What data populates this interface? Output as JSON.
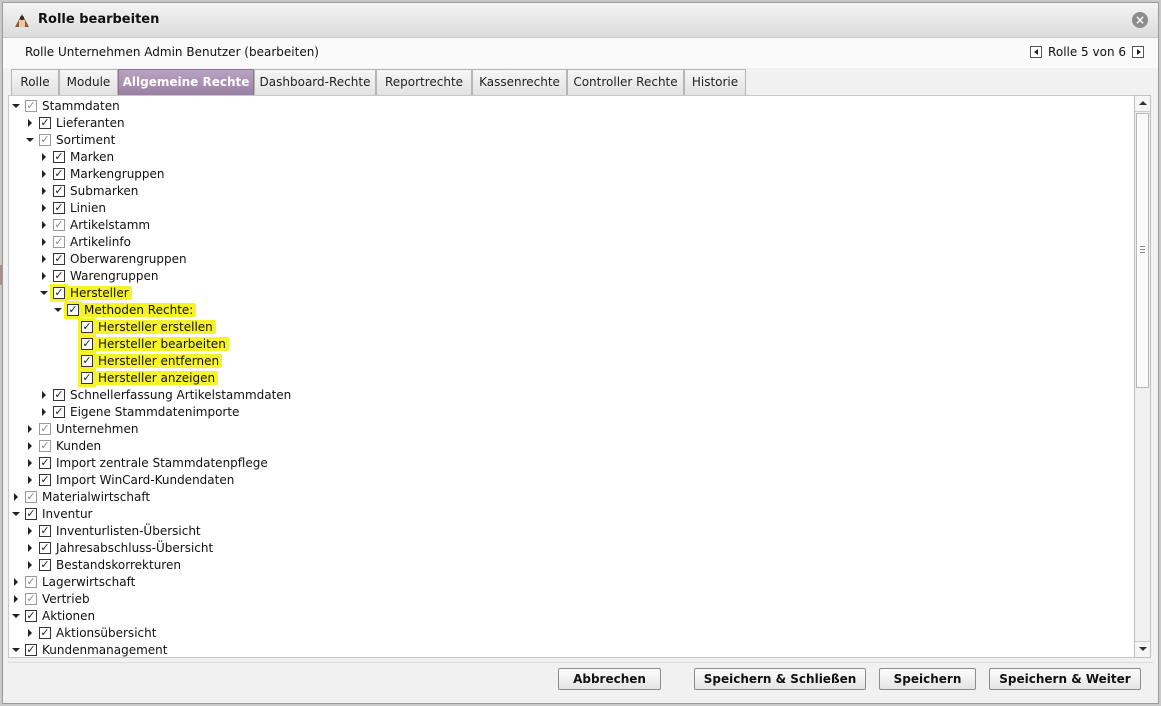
{
  "window": {
    "title": "Rolle bearbeiten",
    "subtitle": "Rolle Unternehmen Admin Benutzer (bearbeiten)",
    "pager_text": "Rolle 5 von 6"
  },
  "tabs": [
    {
      "label": "Rolle"
    },
    {
      "label": "Module"
    },
    {
      "label": "Allgemeine Rechte",
      "active": true
    },
    {
      "label": "Dashboard-Rechte"
    },
    {
      "label": "Reportrechte"
    },
    {
      "label": "Kassenrechte"
    },
    {
      "label": "Controller Rechte"
    },
    {
      "label": "Historie"
    }
  ],
  "tree": [
    {
      "label": "Stammdaten",
      "level": 0,
      "expander": "down",
      "checked": "gray"
    },
    {
      "label": "Lieferanten",
      "level": 1,
      "expander": "right",
      "checked": "yes"
    },
    {
      "label": "Sortiment",
      "level": 1,
      "expander": "down",
      "checked": "gray"
    },
    {
      "label": "Marken",
      "level": 2,
      "expander": "right",
      "checked": "yes"
    },
    {
      "label": "Markengruppen",
      "level": 2,
      "expander": "right",
      "checked": "yes"
    },
    {
      "label": "Submarken",
      "level": 2,
      "expander": "right",
      "checked": "yes"
    },
    {
      "label": "Linien",
      "level": 2,
      "expander": "right",
      "checked": "yes"
    },
    {
      "label": "Artikelstamm",
      "level": 2,
      "expander": "right",
      "checked": "gray"
    },
    {
      "label": "Artikelinfo",
      "level": 2,
      "expander": "right",
      "checked": "gray"
    },
    {
      "label": "Oberwarengruppen",
      "level": 2,
      "expander": "right",
      "checked": "yes"
    },
    {
      "label": "Warengruppen",
      "level": 2,
      "expander": "right",
      "checked": "yes"
    },
    {
      "label": "Hersteller",
      "level": 2,
      "expander": "down",
      "checked": "yes",
      "highlight": true
    },
    {
      "label": "Methoden Rechte:",
      "level": 3,
      "expander": "down",
      "checked": "yes",
      "highlight": true
    },
    {
      "label": "Hersteller erstellen",
      "level": 4,
      "expander": "none",
      "checked": "yes",
      "highlight": true
    },
    {
      "label": "Hersteller bearbeiten",
      "level": 4,
      "expander": "none",
      "checked": "yes",
      "highlight": true
    },
    {
      "label": "Hersteller entfernen",
      "level": 4,
      "expander": "none",
      "checked": "yes",
      "highlight": true
    },
    {
      "label": "Hersteller anzeigen",
      "level": 4,
      "expander": "none",
      "checked": "yes",
      "highlight": true
    },
    {
      "label": "Schnellerfassung Artikelstammdaten",
      "level": 2,
      "expander": "right",
      "checked": "yes"
    },
    {
      "label": "Eigene Stammdatenimporte",
      "level": 2,
      "expander": "right",
      "checked": "yes"
    },
    {
      "label": "Unternehmen",
      "level": 1,
      "expander": "right",
      "checked": "gray"
    },
    {
      "label": "Kunden",
      "level": 1,
      "expander": "right",
      "checked": "gray"
    },
    {
      "label": "Import zentrale Stammdatenpflege",
      "level": 1,
      "expander": "right",
      "checked": "yes"
    },
    {
      "label": "Import WinCard-Kundendaten",
      "level": 1,
      "expander": "right",
      "checked": "yes"
    },
    {
      "label": "Materialwirtschaft",
      "level": 0,
      "expander": "right",
      "checked": "gray"
    },
    {
      "label": "Inventur",
      "level": 0,
      "expander": "down",
      "checked": "yes"
    },
    {
      "label": "Inventurlisten-Übersicht",
      "level": 1,
      "expander": "right",
      "checked": "yes"
    },
    {
      "label": "Jahresabschluss-Übersicht",
      "level": 1,
      "expander": "right",
      "checked": "yes"
    },
    {
      "label": "Bestandskorrekturen",
      "level": 1,
      "expander": "right",
      "checked": "yes"
    },
    {
      "label": "Lagerwirtschaft",
      "level": 0,
      "expander": "right",
      "checked": "gray"
    },
    {
      "label": "Vertrieb",
      "level": 0,
      "expander": "right",
      "checked": "gray"
    },
    {
      "label": "Aktionen",
      "level": 0,
      "expander": "down",
      "checked": "yes"
    },
    {
      "label": "Aktionsübersicht",
      "level": 1,
      "expander": "right",
      "checked": "yes"
    },
    {
      "label": "Kundenmanagement",
      "level": 0,
      "expander": "down",
      "checked": "yes"
    }
  ],
  "buttons": {
    "cancel": "Abbrechen",
    "save_close": "Speichern & Schließen",
    "save": "Speichern",
    "save_next": "Speichern & Weiter"
  },
  "colors": {
    "active_tab": "#9a7fa3",
    "highlight": "#f6f32a"
  }
}
